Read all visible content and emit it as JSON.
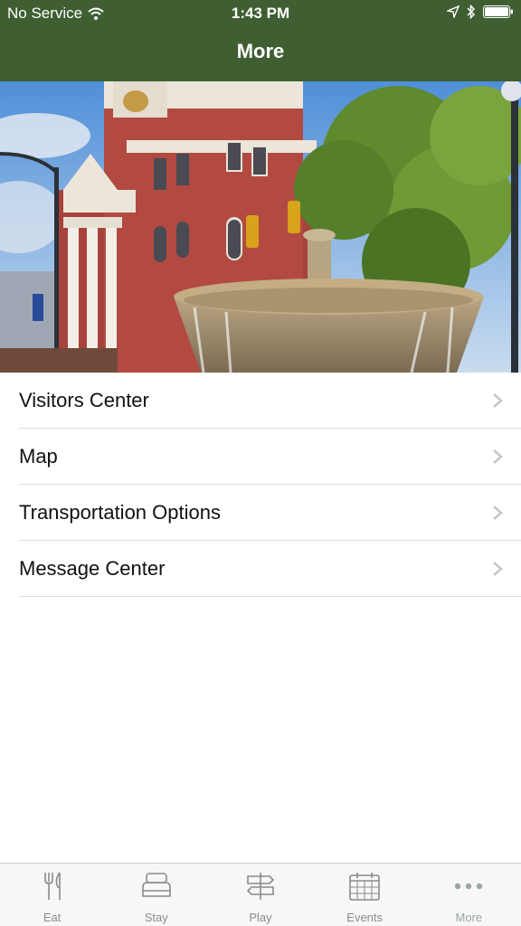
{
  "status_bar": {
    "carrier": "No Service",
    "time": "1:43 PM"
  },
  "nav": {
    "title": "More"
  },
  "menu": {
    "items": [
      {
        "label": "Visitors Center"
      },
      {
        "label": "Map"
      },
      {
        "label": "Transportation Options"
      },
      {
        "label": "Message Center"
      }
    ]
  },
  "tabs": [
    {
      "label": "Eat",
      "icon": "fork-knife-icon"
    },
    {
      "label": "Stay",
      "icon": "bed-icon"
    },
    {
      "label": "Play",
      "icon": "signpost-icon"
    },
    {
      "label": "Events",
      "icon": "calendar-icon"
    },
    {
      "label": "More",
      "icon": "more-dots-icon",
      "active": true
    }
  ],
  "colors": {
    "header": "#3f5f33",
    "tab_inactive": "#8a8a8a",
    "tab_active": "#9aa7a0",
    "chevron": "#c4c4c4"
  }
}
